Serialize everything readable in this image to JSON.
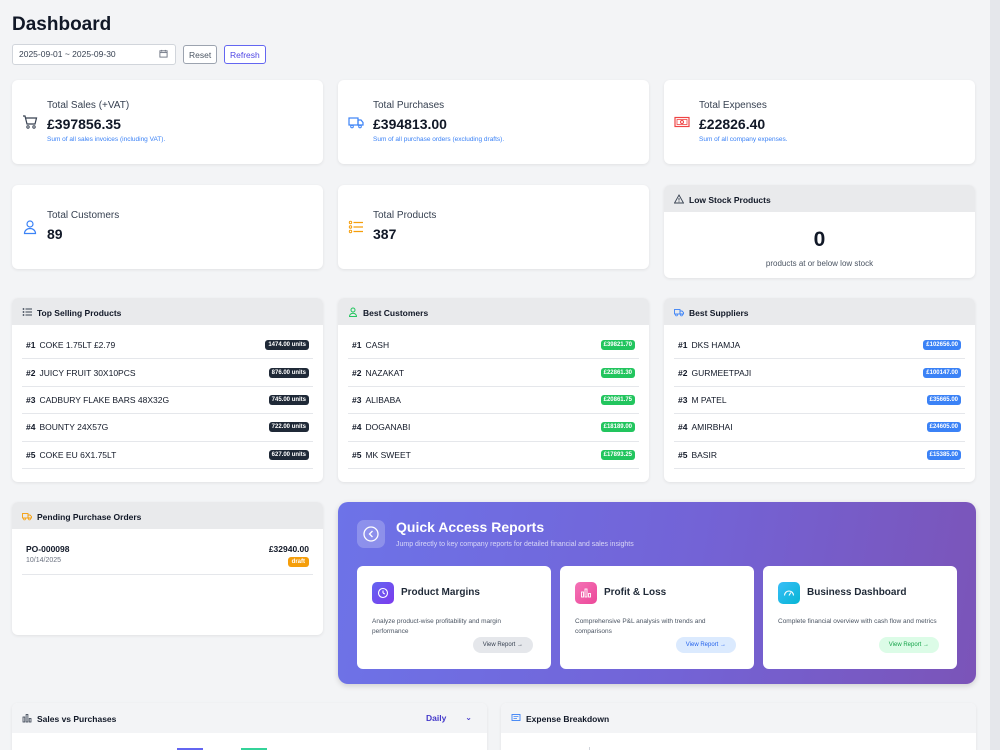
{
  "header": {
    "title": "Dashboard",
    "date_range": "2025-09-01 ~ 2025-09-30",
    "reset_label": "Reset",
    "refresh_label": "Refresh"
  },
  "stats": {
    "total_sales": {
      "label": "Total Sales (+VAT)",
      "value": "£397856.35",
      "note": "Sum of all sales invoices (including VAT)."
    },
    "total_purchases": {
      "label": "Total Purchases",
      "value": "£394813.00",
      "note": "Sum of all purchase orders (excluding drafts)."
    },
    "total_expenses": {
      "label": "Total Expenses",
      "value": "£22826.40",
      "note": "Sum of all company expenses."
    },
    "total_customers": {
      "label": "Total Customers",
      "value": "89"
    },
    "total_products": {
      "label": "Total Products",
      "value": "387"
    }
  },
  "low_stock": {
    "title": "Low Stock Products",
    "count": "0",
    "note": "products at or below low stock"
  },
  "top_selling": {
    "title": "Top Selling Products",
    "items": [
      {
        "rank": "#1",
        "name": "COKE 1.75LT £2.79",
        "value": "1474.00 units"
      },
      {
        "rank": "#2",
        "name": "JUICY FRUIT 30X10PCS",
        "value": "876.00 units"
      },
      {
        "rank": "#3",
        "name": "CADBURY FLAKE BARS 48X32G",
        "value": "745.00 units"
      },
      {
        "rank": "#4",
        "name": "BOUNTY 24X57G",
        "value": "722.00 units"
      },
      {
        "rank": "#5",
        "name": "COKE EU 6X1.75LT",
        "value": "627.00 units"
      }
    ]
  },
  "best_customers": {
    "title": "Best Customers",
    "items": [
      {
        "rank": "#1",
        "name": "CASH",
        "value": "£39821.70"
      },
      {
        "rank": "#2",
        "name": "NAZAKAT",
        "value": "£22861.30"
      },
      {
        "rank": "#3",
        "name": "ALIBABA",
        "value": "£20861.75"
      },
      {
        "rank": "#4",
        "name": "DOGANABI",
        "value": "£18189.00"
      },
      {
        "rank": "#5",
        "name": "MK SWEET",
        "value": "£17893.25"
      }
    ]
  },
  "best_suppliers": {
    "title": "Best Suppliers",
    "items": [
      {
        "rank": "#1",
        "name": "DKS HAMJA",
        "value": "£102656.00"
      },
      {
        "rank": "#2",
        "name": "GURMEETPAJI",
        "value": "£100147.00"
      },
      {
        "rank": "#3",
        "name": "M PATEL",
        "value": "£35665.00"
      },
      {
        "rank": "#4",
        "name": "AMIRBHAI",
        "value": "£24605.00"
      },
      {
        "rank": "#5",
        "name": "BASIR",
        "value": "£15385.00"
      }
    ]
  },
  "pending_po": {
    "title": "Pending Purchase Orders",
    "items": [
      {
        "number": "PO-000098",
        "date": "10/14/2025",
        "amount": "£32940.00",
        "status": "draft"
      }
    ]
  },
  "quick_access": {
    "title": "Quick Access Reports",
    "subtitle": "Jump directly to key company reports for detailed financial and sales insights",
    "reports": [
      {
        "title": "Product Margins",
        "desc": "Analyze product-wise profitability and margin performance",
        "button": "View Report →"
      },
      {
        "title": "Profit & Loss",
        "desc": "Comprehensive P&L analysis with trends and comparisons",
        "button": "View Report →"
      },
      {
        "title": "Business Dashboard",
        "desc": "Complete financial overview with cash flow and metrics",
        "button": "View Report →"
      }
    ]
  },
  "sales_vs_purchases": {
    "title": "Sales vs Purchases",
    "period": "Daily"
  },
  "expense_breakdown": {
    "title": "Expense Breakdown"
  },
  "colors": {
    "sales_icon": "#374151",
    "purchases_icon": "#3b82f6",
    "expenses_icon": "#ef4444",
    "customers_icon": "#3b82f6",
    "products_icon": "#f59e0b",
    "green_badge": "#22c55e",
    "blue_badge": "#3b82f6",
    "dark_badge": "#1f2937",
    "draft_badge": "#f59e0b"
  },
  "icons": {
    "sales": "cart-icon",
    "purchases": "truck-icon",
    "expenses": "money-icon",
    "customers": "user-icon",
    "products": "list-icon",
    "low_stock": "warning-icon"
  }
}
